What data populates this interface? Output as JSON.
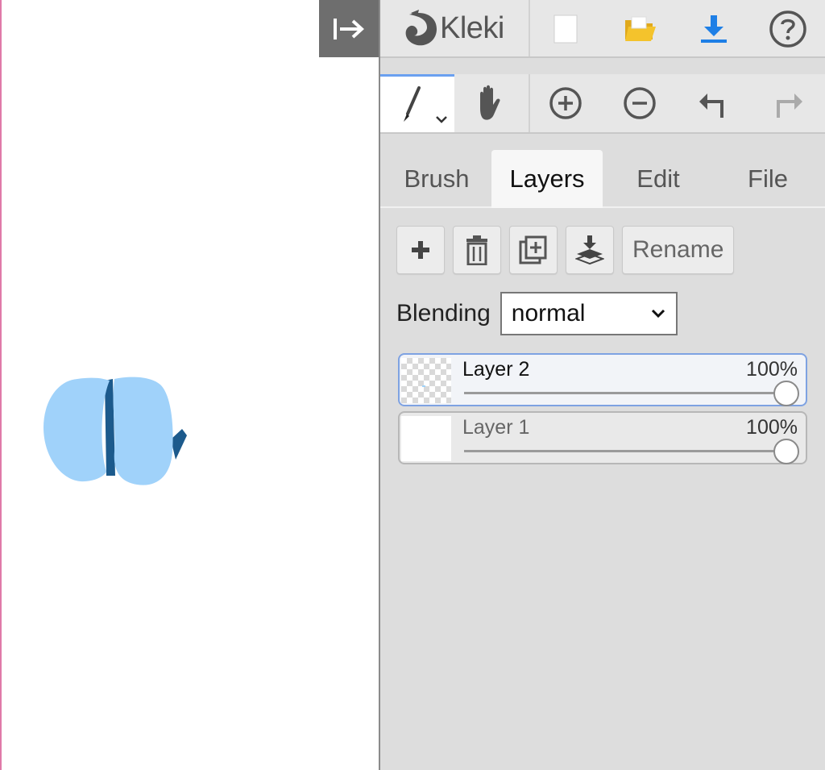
{
  "app": {
    "name": "Kleki"
  },
  "topbar": {
    "new_icon": "new-image-icon",
    "open_icon": "folder-open-icon",
    "save_icon": "download-icon",
    "help_icon": "help-icon"
  },
  "toolbar": {
    "tools": [
      "brush-tool",
      "hand-tool",
      "zoom-in",
      "zoom-out",
      "undo",
      "redo"
    ],
    "active_tool": "brush-tool"
  },
  "tabs": [
    {
      "label": "Brush"
    },
    {
      "label": "Layers"
    },
    {
      "label": "Edit"
    },
    {
      "label": "File"
    }
  ],
  "active_tab": "Layers",
  "layers_panel": {
    "rename_label": "Rename",
    "blending_label": "Blending",
    "blending_value": "normal",
    "layers": [
      {
        "name": "Layer 2",
        "opacity": "100%",
        "selected": true
      },
      {
        "name": "Layer 1",
        "opacity": "100%",
        "selected": false
      }
    ]
  },
  "colors": {
    "accent": "#6aa0f0",
    "paint_light": "#a0d2fa",
    "paint_dark": "#1c5a8c",
    "panel_bg": "#dddddd",
    "collapse_bg": "#6e6e6e"
  }
}
